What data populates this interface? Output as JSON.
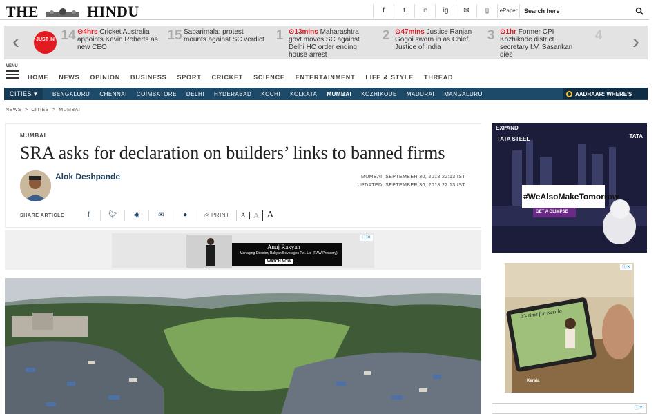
{
  "header": {
    "logo_left": "THE",
    "logo_right": "HINDU",
    "social": [
      "f",
      "t",
      "in",
      "ig",
      "✉",
      "▯"
    ],
    "epaper": "ePaper",
    "search_label": "Search here"
  },
  "ticker": {
    "badge": "JUST IN",
    "items": [
      {
        "num": "14",
        "time": "4hrs",
        "text": "Cricket Australia appoints Kevin Roberts as new CEO"
      },
      {
        "num": "15",
        "time": "",
        "text": "Sabarimala: protest mounts against SC verdict"
      },
      {
        "num": "1",
        "time": "13mins",
        "text": "Maharashtra govt moves SC against Delhi HC order ending house arrest"
      },
      {
        "num": "2",
        "time": "47mins",
        "text": "Justice Ranjan Gogoi sworn in as Chief Justice of India"
      },
      {
        "num": "3",
        "time": "1hr",
        "text": "Former CPI Kozhikode district secretary I.V. Sasankan dies"
      },
      {
        "num": "4",
        "time": "",
        "text": ""
      }
    ]
  },
  "nav": {
    "menu_label": "MENU",
    "items": [
      "HOME",
      "NEWS",
      "OPINION",
      "BUSINESS",
      "SPORT",
      "CRICKET",
      "SCIENCE",
      "ENTERTAINMENT",
      "LIFE & STYLE",
      "THREAD"
    ]
  },
  "cities": {
    "label": "CITIES",
    "items": [
      "BENGALURU",
      "CHENNAI",
      "COIMBATORE",
      "DELHI",
      "HYDERABAD",
      "KOCHI",
      "KOLKATA",
      "MUMBAI",
      "KOZHIKODE",
      "MADURAI",
      "MANGALURU"
    ],
    "active": "MUMBAI",
    "promo": "AADHAAR: WHERE'S"
  },
  "breadcrumb": "NEWS  >  CITIES  >  MUMBAI",
  "article": {
    "section": "MUMBAI",
    "headline": "SRA asks for declaration on builders’ links to banned firms",
    "author": "Alok Deshpande",
    "dateline": "MUMBAI, SEPTEMBER 30, 2018 22:13 IST",
    "updated": "UPDATED: SEPTEMBER 30, 2018 22:13 IST",
    "share_label": "SHARE ARTICLE",
    "print_label": "PRINT",
    "font_sizes": [
      "A",
      "A",
      "A"
    ]
  },
  "ads": {
    "inline_name": "Anuj Rakyan",
    "inline_sub": "Managing Director, Rakyan Beverages Pvt. Ltd (RAW Pressery)",
    "inline_cta": "WATCH NOW",
    "tata_expand": "EXPAND",
    "tata_brand": "TATA STEEL",
    "tata_tag": "#WeAlsoMakeTomorrow",
    "tata_cta": "GET A GLIMPSE",
    "tata_logo": "TATA",
    "kerala_text": "It's time for Kerala",
    "kerala_brand": "Kerala"
  }
}
